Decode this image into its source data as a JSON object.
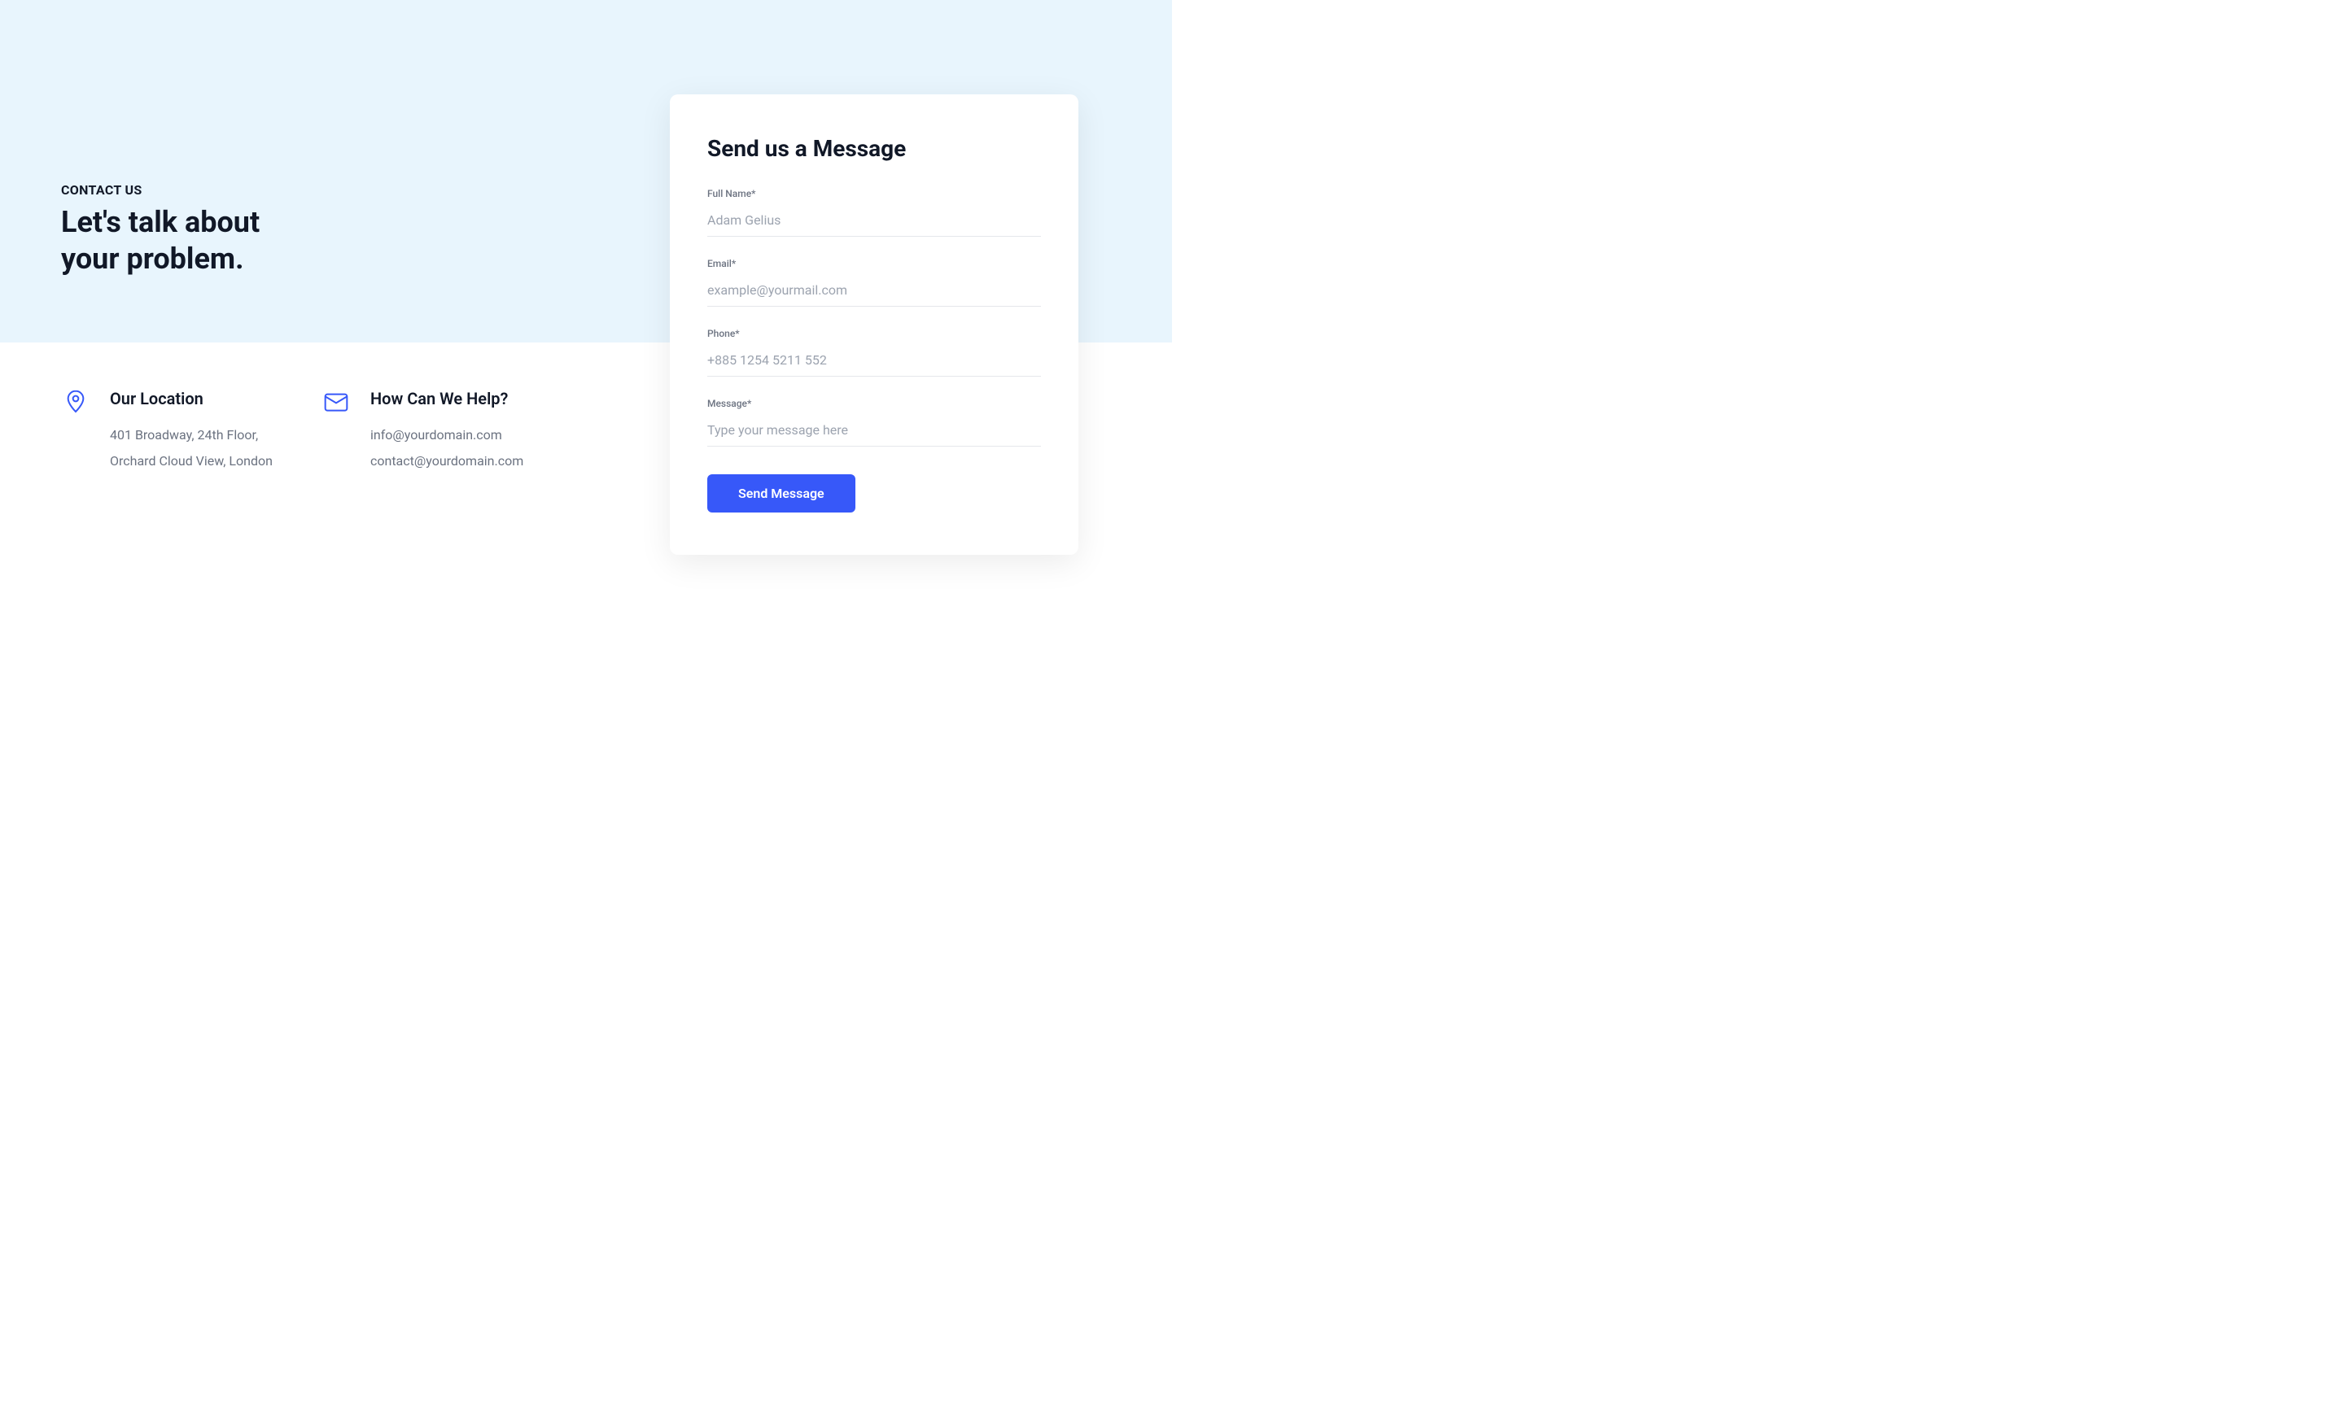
{
  "header": {
    "eyebrow": "CONTACT US",
    "headline": "Let's talk about your problem."
  },
  "location": {
    "title": "Our Location",
    "line1": "401 Broadway, 24th Floor,",
    "line2": "Orchard Cloud View, London"
  },
  "help": {
    "title": "How Can We Help?",
    "email1": "info@yourdomain.com",
    "email2": "contact@yourdomain.com"
  },
  "form": {
    "title": "Send us a Message",
    "fullname_label": "Full Name*",
    "fullname_placeholder": "Adam Gelius",
    "email_label": "Email*",
    "email_placeholder": "example@yourmail.com",
    "phone_label": "Phone*",
    "phone_placeholder": "+885 1254 5211 552",
    "message_label": "Message*",
    "message_placeholder": "Type your message here",
    "submit_label": "Send Message"
  },
  "colors": {
    "primary": "#3758f9",
    "background_light": "#e8f5fd",
    "text_dark": "#111827",
    "text_muted": "#6b7280"
  }
}
